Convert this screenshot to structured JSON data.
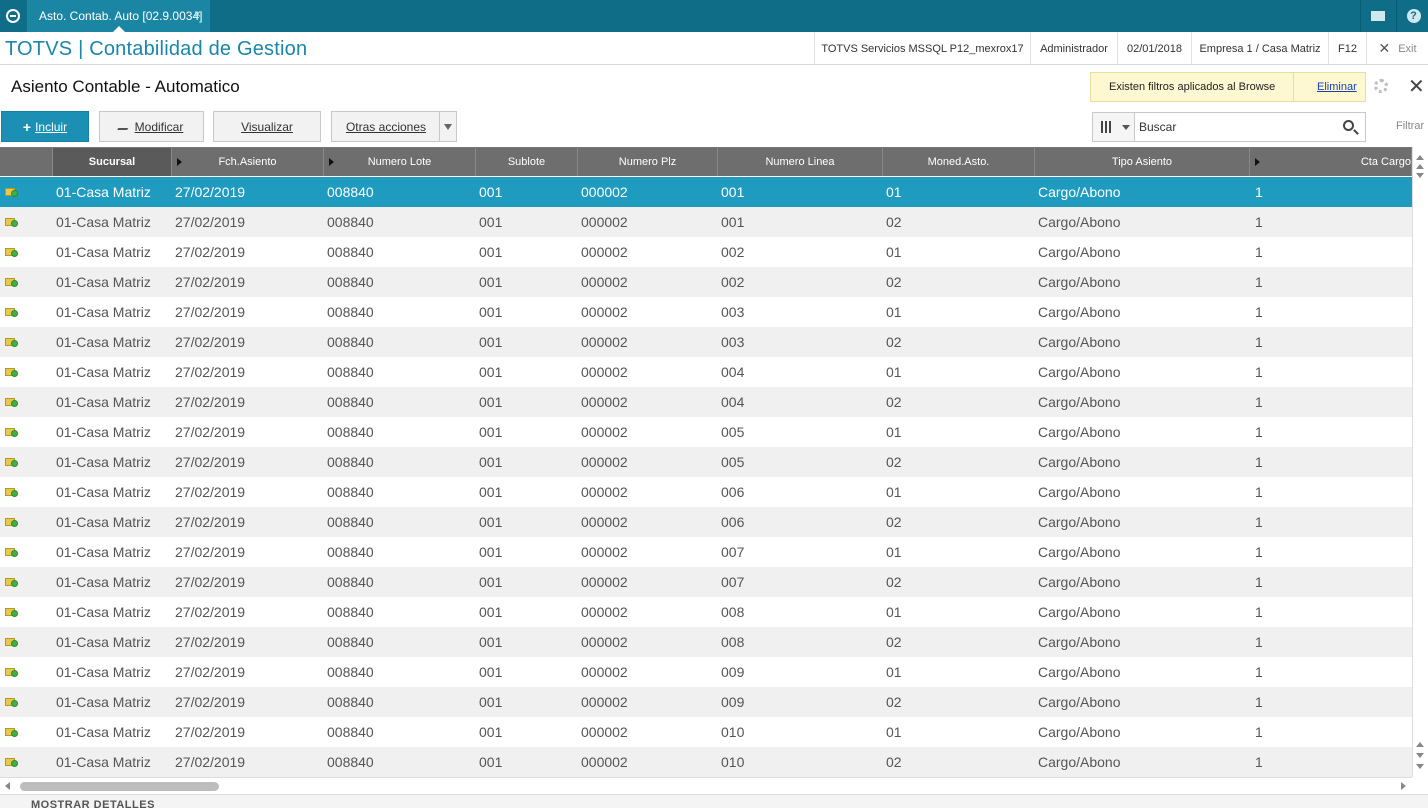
{
  "window": {
    "tab_title": "Asto. Contab. Auto [02.9.0034]",
    "tab_close": "×"
  },
  "appbar": {
    "brand": "TOTVS | Contabilidad de Gestion",
    "server": "TOTVS Servicios MSSQL P12_mexrox17",
    "user": "Administrador",
    "date": "02/01/2018",
    "company": "Empresa 1 / Casa Matriz",
    "shortcut": "F12",
    "exit_label": "Exit"
  },
  "page": {
    "title": "Asiento Contable - Automatico",
    "filter_message": "Existen filtros aplicados al Browse",
    "filter_remove": "Eliminar",
    "close_symbol": "✕"
  },
  "toolbar": {
    "include_label": "Incluir",
    "modify_label": "Modificar",
    "view_label": "Visualizar",
    "other_label": "Otras acciones"
  },
  "search": {
    "placeholder": "Buscar",
    "filter_label": "Filtrar"
  },
  "grid": {
    "columns": [
      "Sucursal",
      "Fch.Asiento",
      "Numero Lote",
      "Sublote",
      "Numero Plz",
      "Numero Linea",
      "Moned.Asto.",
      "Tipo Asiento",
      "Cta Cargo"
    ],
    "rows": [
      [
        "01-Casa Matriz",
        "27/02/2019",
        "008840",
        "001",
        "000002",
        "001",
        "01",
        "Cargo/Abono",
        "1"
      ],
      [
        "01-Casa Matriz",
        "27/02/2019",
        "008840",
        "001",
        "000002",
        "001",
        "02",
        "Cargo/Abono",
        "1"
      ],
      [
        "01-Casa Matriz",
        "27/02/2019",
        "008840",
        "001",
        "000002",
        "002",
        "01",
        "Cargo/Abono",
        "1"
      ],
      [
        "01-Casa Matriz",
        "27/02/2019",
        "008840",
        "001",
        "000002",
        "002",
        "02",
        "Cargo/Abono",
        "1"
      ],
      [
        "01-Casa Matriz",
        "27/02/2019",
        "008840",
        "001",
        "000002",
        "003",
        "01",
        "Cargo/Abono",
        "1"
      ],
      [
        "01-Casa Matriz",
        "27/02/2019",
        "008840",
        "001",
        "000002",
        "003",
        "02",
        "Cargo/Abono",
        "1"
      ],
      [
        "01-Casa Matriz",
        "27/02/2019",
        "008840",
        "001",
        "000002",
        "004",
        "01",
        "Cargo/Abono",
        "1"
      ],
      [
        "01-Casa Matriz",
        "27/02/2019",
        "008840",
        "001",
        "000002",
        "004",
        "02",
        "Cargo/Abono",
        "1"
      ],
      [
        "01-Casa Matriz",
        "27/02/2019",
        "008840",
        "001",
        "000002",
        "005",
        "01",
        "Cargo/Abono",
        "1"
      ],
      [
        "01-Casa Matriz",
        "27/02/2019",
        "008840",
        "001",
        "000002",
        "005",
        "02",
        "Cargo/Abono",
        "1"
      ],
      [
        "01-Casa Matriz",
        "27/02/2019",
        "008840",
        "001",
        "000002",
        "006",
        "01",
        "Cargo/Abono",
        "1"
      ],
      [
        "01-Casa Matriz",
        "27/02/2019",
        "008840",
        "001",
        "000002",
        "006",
        "02",
        "Cargo/Abono",
        "1"
      ],
      [
        "01-Casa Matriz",
        "27/02/2019",
        "008840",
        "001",
        "000002",
        "007",
        "01",
        "Cargo/Abono",
        "1"
      ],
      [
        "01-Casa Matriz",
        "27/02/2019",
        "008840",
        "001",
        "000002",
        "007",
        "02",
        "Cargo/Abono",
        "1"
      ],
      [
        "01-Casa Matriz",
        "27/02/2019",
        "008840",
        "001",
        "000002",
        "008",
        "01",
        "Cargo/Abono",
        "1"
      ],
      [
        "01-Casa Matriz",
        "27/02/2019",
        "008840",
        "001",
        "000002",
        "008",
        "02",
        "Cargo/Abono",
        "1"
      ],
      [
        "01-Casa Matriz",
        "27/02/2019",
        "008840",
        "001",
        "000002",
        "009",
        "01",
        "Cargo/Abono",
        "1"
      ],
      [
        "01-Casa Matriz",
        "27/02/2019",
        "008840",
        "001",
        "000002",
        "009",
        "02",
        "Cargo/Abono",
        "1"
      ],
      [
        "01-Casa Matriz",
        "27/02/2019",
        "008840",
        "001",
        "000002",
        "010",
        "01",
        "Cargo/Abono",
        "1"
      ],
      [
        "01-Casa Matriz",
        "27/02/2019",
        "008840",
        "001",
        "000002",
        "010",
        "02",
        "Cargo/Abono",
        "1"
      ]
    ]
  },
  "footer": {
    "details_label": "MOSTRAR DETALLES"
  },
  "colors": {
    "topbar": "#0f6d87",
    "brand": "#1a86a8",
    "selected_row": "#1f9bbf",
    "header": "#6e6e6e"
  },
  "icons": {
    "logo": "totvs-logo-icon",
    "mail": "mail-icon",
    "help": "help-icon",
    "gear": "gear-icon",
    "row_status": "folder-status-icon"
  }
}
